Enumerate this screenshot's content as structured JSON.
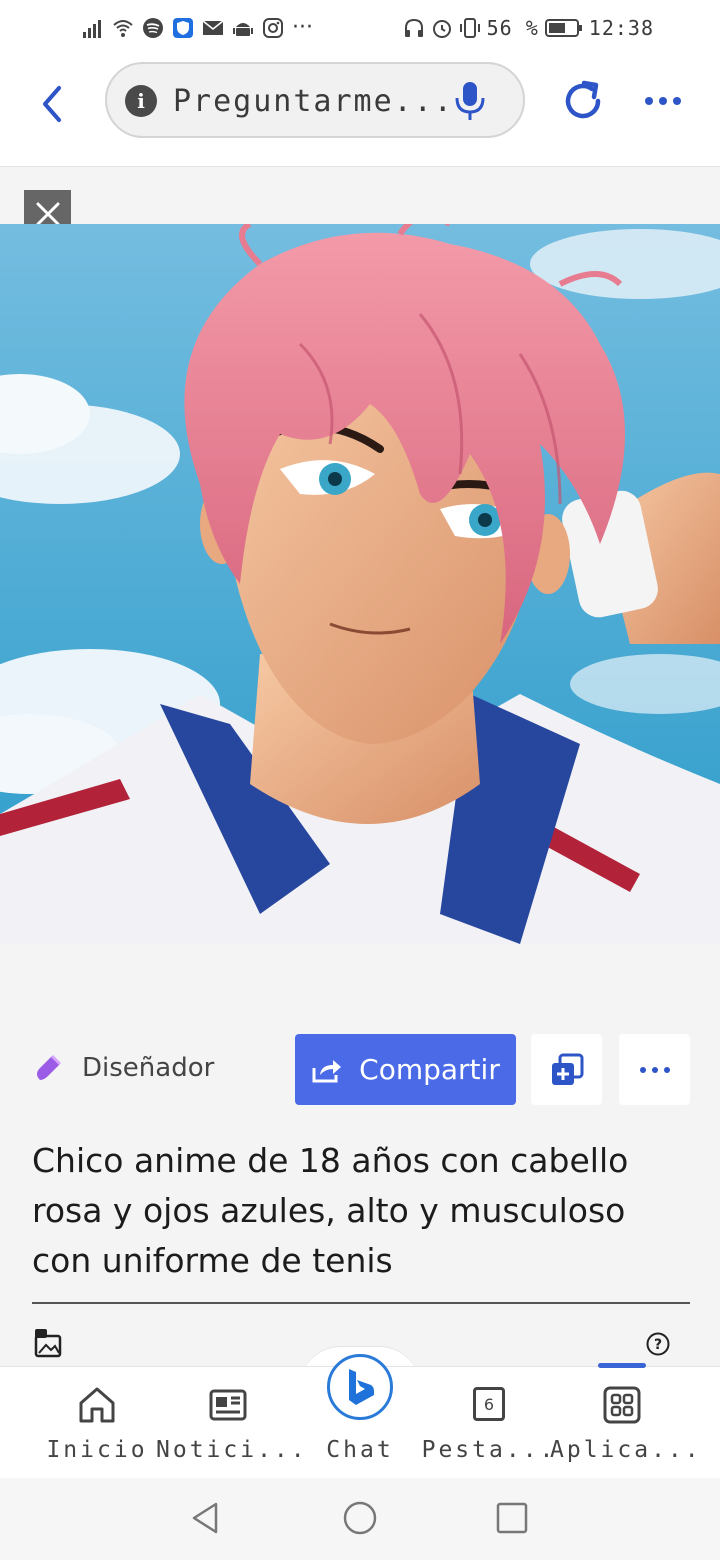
{
  "status_bar": {
    "battery_percent": "56 %",
    "time": "12:38",
    "left_icons": [
      "signal-icon",
      "wifi-icon",
      "spotify-icon",
      "shield-icon",
      "mail-icon",
      "android-icon",
      "instagram-icon",
      "more-dots-icon"
    ],
    "right_icons": [
      "headphones-icon",
      "alarm-icon",
      "vibrate-icon",
      "battery-icon"
    ]
  },
  "browser": {
    "search_placeholder": "Preguntarme...",
    "accent_color": "#2d55c8"
  },
  "creator": {
    "label": "Diseñador"
  },
  "actions": {
    "share_label": "Compartir"
  },
  "prompt": {
    "text": "Chico anime de 18 años con cabello rosa y ojos azules, alto y musculoso con uniforme de tenis"
  },
  "bottom_nav": {
    "items": [
      {
        "label": "Inicio",
        "icon": "home-icon"
      },
      {
        "label": "Notici...",
        "icon": "news-icon"
      },
      {
        "label": "Chat",
        "icon": "bing-chat-icon"
      },
      {
        "label": "Pesta...",
        "icon": "tabs-icon",
        "count": "6"
      },
      {
        "label": "Aplica...",
        "icon": "apps-icon"
      }
    ]
  }
}
